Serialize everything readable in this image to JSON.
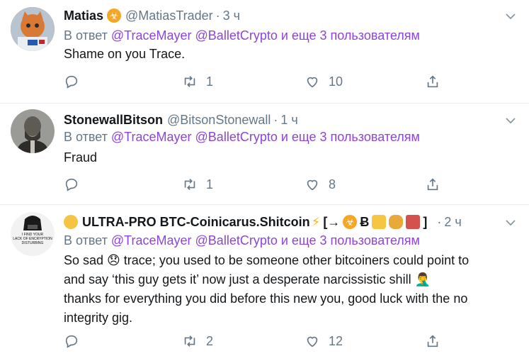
{
  "tweets": [
    {
      "name": "Matias",
      "handle": "@MatiasTrader",
      "time": "3 ч",
      "reply_prefix": "В ответ",
      "reply_links": "@TraceMayer @BalletCrypto и еще 3 пользователям",
      "text": "Shame on you Trace.",
      "replies": "",
      "retweets": "1",
      "likes": "10"
    },
    {
      "name": "StonewallBitson",
      "handle": "@BitsonStonewall",
      "time": "1 ч",
      "reply_prefix": "В ответ",
      "reply_links": "@TraceMayer @BalletCrypto и еще 3 пользователям",
      "text": "Fraud",
      "replies": "",
      "retweets": "1",
      "likes": "8"
    },
    {
      "name": "ULTRA-PRO BTC-Coinicarus.Shitcoin",
      "name_suffix": "[→",
      "name_suffix_end": "]",
      "time": "2 ч",
      "reply_prefix": "В ответ",
      "reply_links": "@TraceMayer @BalletCrypto и еще 3 пользователям",
      "text_lines": [
        "So sad 😞 trace; you used to be someone other bitcoiners could point to",
        "and say ‘this guy gets it’ now just a desperate narcissistic shill 🤦‍♂️",
        "thanks for everything you did before this new you, good luck with the no",
        "integrity gig."
      ],
      "replies": "",
      "retweets": "2",
      "likes": "12"
    }
  ],
  "avatar3_text": "I FIND YOUR LACK OF ENCRYPTION DISTURBING",
  "colors": {
    "link": "#8e44d8",
    "secondary": "#657786",
    "divider": "#e6ecf0"
  },
  "icons": [
    "reply-icon",
    "retweet-icon",
    "like-icon",
    "share-icon",
    "chevron-down-icon",
    "biohazard-icon"
  ]
}
